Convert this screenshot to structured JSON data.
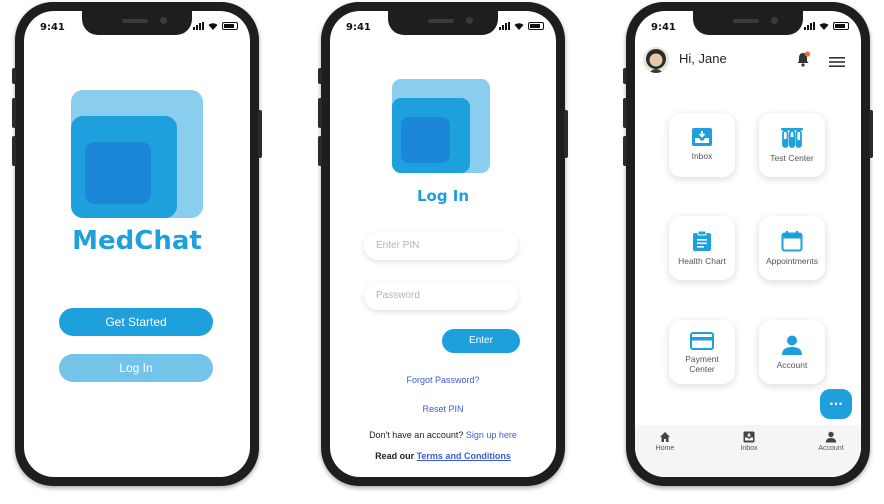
{
  "status_time": "9:41",
  "screen1": {
    "app_name": "MedChat",
    "get_started_label": "Get Started",
    "login_label": "Log In"
  },
  "screen2": {
    "title": "Log In",
    "pin_placeholder": "Enter PIN",
    "password_placeholder": "Password",
    "enter_label": "Enter",
    "forgot_password": "Forgot Password?",
    "reset_pin": "Reset PIN",
    "no_account_text": "Don't have an account?",
    "sign_up_link": "Sign up here",
    "read_our_text": "Read our",
    "terms_link": "Terms and Conditions"
  },
  "screen3": {
    "greeting": "Hi, Jane",
    "tiles": [
      {
        "label": "Inbox",
        "icon": "inbox-icon"
      },
      {
        "label": "Test Center",
        "icon": "test-tubes-icon"
      },
      {
        "label": "Health Chart",
        "icon": "clipboard-icon"
      },
      {
        "label": "Appointments",
        "icon": "calendar-icon"
      },
      {
        "label": "Payment Center",
        "icon": "credit-card-icon"
      },
      {
        "label": "Account",
        "icon": "person-icon"
      }
    ],
    "chat_fab_label": "...",
    "nav": [
      {
        "label": "Home",
        "icon": "home-icon"
      },
      {
        "label": "Inbox",
        "icon": "inbox-icon"
      },
      {
        "label": "Account",
        "icon": "person-icon"
      }
    ]
  },
  "colors": {
    "primary": "#1ea0dc",
    "light_primary": "#89cdef",
    "dark_primary": "#1c86d8",
    "link": "#3b5bdb",
    "notification": "#f26b3a"
  }
}
